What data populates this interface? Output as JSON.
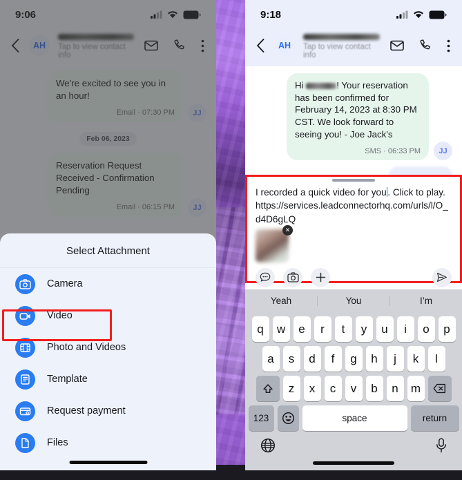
{
  "left_phone": {
    "status": {
      "time": "9:06",
      "signal_icon": "cellular-signal-icon",
      "wifi_icon": "wifi-icon",
      "battery_icon": "battery-icon"
    },
    "header": {
      "back_icon": "back-chevron-icon",
      "avatar_initials": "AH",
      "contact_name_redacted": "",
      "subtitle": "Tap to view contact info",
      "mail_icon": "mail-icon",
      "call_icon": "phone-icon",
      "more_icon": "more-vertical-icon"
    },
    "messages": [
      {
        "text": "We're excited to see you in an hour!",
        "meta": "Email · 07:30 PM",
        "avatar": "JJ"
      },
      {
        "text": "Reservation Request Received - Confirmation Pending",
        "meta": "Email · 06:15 PM",
        "avatar": "JJ"
      }
    ],
    "day_separator": "Feb 06, 2023",
    "attachment_sheet": {
      "title": "Select Attachment",
      "items": [
        {
          "label": "Camera",
          "icon": "camera-icon"
        },
        {
          "label": "Video",
          "icon": "video-camera-icon"
        },
        {
          "label": "Photo and Videos",
          "icon": "photo-library-icon"
        },
        {
          "label": "Template",
          "icon": "template-document-icon"
        },
        {
          "label": "Request payment",
          "icon": "payment-card-icon"
        },
        {
          "label": "Files",
          "icon": "file-icon"
        }
      ],
      "highlighted_item": "Video",
      "highlight_color": "#f31d1d"
    }
  },
  "right_phone": {
    "status": {
      "time": "9:18",
      "signal_icon": "cellular-signal-icon",
      "wifi_icon": "wifi-icon",
      "battery_icon": "battery-icon"
    },
    "header": {
      "back_icon": "back-chevron-icon",
      "avatar_initials": "AH",
      "contact_name_redacted": "",
      "subtitle": "Tap to view contact info",
      "mail_icon": "mail-icon",
      "call_icon": "phone-icon",
      "more_icon": "more-vertical-icon"
    },
    "messages": [
      {
        "text_prefix": "Hi",
        "text": "! Your reservation has been confirmed for February 14, 2023 at 8:30 PM CST. We look forward to seeing you! - Joe Jack's",
        "meta": "SMS · 06:33 PM",
        "avatar": "JJ"
      }
    ],
    "composer": {
      "highlight_color": "#f31d1d",
      "text_line1": "I recorded a quick video for you",
      "text_line2": ". Click to play.",
      "url": "https://services.leadconnectorhq.com/urls/l/O_d4D6gLQ",
      "attachment_thumb": "video-thumbnail",
      "remove_icon": "close-x-icon",
      "actions": [
        {
          "name": "quick-reply",
          "icon": "chat-bubble-icon"
        },
        {
          "name": "camera",
          "icon": "camera-icon"
        },
        {
          "name": "add-attachment",
          "icon": "plus-icon"
        }
      ],
      "send_icon": "send-icon"
    },
    "keyboard": {
      "suggestions": [
        "Yeah",
        "You",
        "I’m"
      ],
      "row1": [
        "q",
        "w",
        "e",
        "r",
        "t",
        "y",
        "u",
        "i",
        "o",
        "p"
      ],
      "row2": [
        "a",
        "s",
        "d",
        "f",
        "g",
        "h",
        "j",
        "k",
        "l"
      ],
      "row3": [
        "z",
        "x",
        "c",
        "v",
        "b",
        "n",
        "m"
      ],
      "shift_icon": "shift-up-icon",
      "backspace_icon": "backspace-icon",
      "numeric_key": "123",
      "emoji_icon": "emoji-smiley-icon",
      "space_key": "space",
      "return_key": "return",
      "globe_icon": "globe-language-icon",
      "mic_icon": "microphone-icon"
    }
  }
}
